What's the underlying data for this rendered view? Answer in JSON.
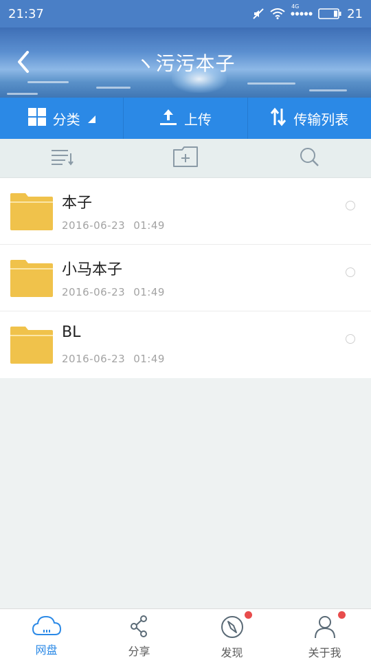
{
  "status_bar": {
    "time": "21:37",
    "network": "4G",
    "battery": "21"
  },
  "header": {
    "title": "ヽ污污本子"
  },
  "action_bar": {
    "category_label": "分类",
    "upload_label": "上传",
    "transfer_label": "传输列表"
  },
  "files": [
    {
      "name": "本子",
      "date": "2016-06-23",
      "time": "01:49"
    },
    {
      "name": "小马本子",
      "date": "2016-06-23",
      "time": "01:49"
    },
    {
      "name": "BL",
      "date": "2016-06-23",
      "time": "01:49"
    }
  ],
  "bottom_nav": [
    {
      "label": "网盘",
      "icon": "cloud-icon",
      "active": true
    },
    {
      "label": "分享",
      "icon": "share-icon"
    },
    {
      "label": "发现",
      "icon": "compass-icon",
      "badge": true
    },
    {
      "label": "关于我",
      "icon": "user-icon",
      "badge": true
    }
  ],
  "colors": {
    "accent": "#2b89e6",
    "folder": "#f0c24b",
    "badge": "#e84c4c"
  }
}
